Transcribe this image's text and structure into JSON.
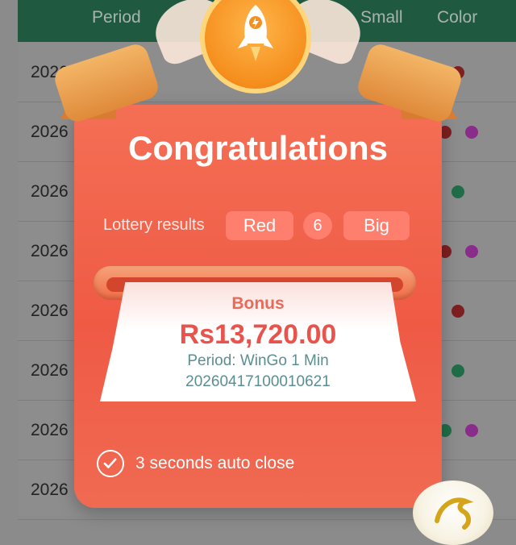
{
  "table": {
    "headers": {
      "period": "Period",
      "small": "Small",
      "color": "Color"
    },
    "rows": [
      {
        "id": "2026"
      },
      {
        "id": "2026"
      },
      {
        "id": "2026"
      },
      {
        "id": "2026"
      },
      {
        "id": "2026"
      },
      {
        "id": "2026"
      },
      {
        "id": "2026"
      },
      {
        "id": "2026"
      }
    ]
  },
  "modal": {
    "title": "Congratulations",
    "lottery_results_label": "Lottery results",
    "result_color": "Red",
    "result_number": "6",
    "result_size": "Big",
    "bonus_label": "Bonus",
    "bonus_amount": "Rs13,720.00",
    "period_line": "Period: WinGo 1 Min",
    "period_id": "20260417100010621",
    "autoclose_text": "3 seconds auto close"
  },
  "icons": {
    "medal": "rocket-icon",
    "autoclose": "check-circle-icon",
    "logo": "dragon-logo-icon"
  },
  "colors": {
    "header_green": "#1f5a40",
    "modal_red": "#ef5a45",
    "bonus_text": "#e8544d",
    "dot_red": "#7e1f21",
    "dot_violet": "#8a2c89",
    "dot_green": "#1f6e49"
  }
}
